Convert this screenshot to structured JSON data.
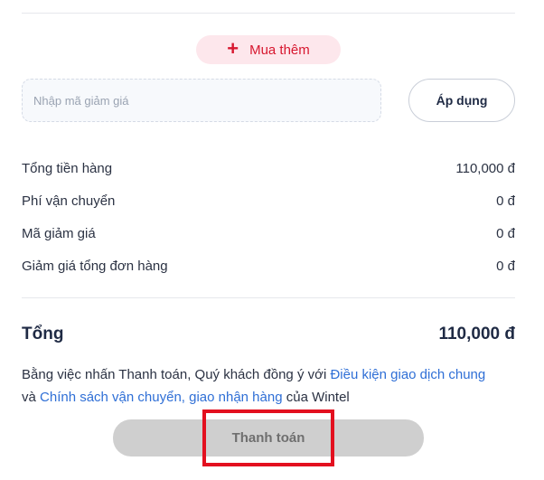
{
  "cart_actions": {
    "add_more_label": "Mua thêm",
    "add_more_icon": "plus-icon"
  },
  "coupon": {
    "placeholder": "Nhập mã giảm giá",
    "value": "",
    "apply_label": "Áp dụng"
  },
  "summary": {
    "rows": [
      {
        "label": "Tổng tiền hàng",
        "value": "110,000 đ"
      },
      {
        "label": "Phí vận chuyển",
        "value": "0 đ"
      },
      {
        "label": "Mã giảm giá",
        "value": "0 đ"
      },
      {
        "label": "Giảm giá tổng đơn hàng",
        "value": "0 đ"
      }
    ],
    "total_label": "Tổng",
    "total_value": "110,000 đ"
  },
  "terms": {
    "prefix": "Bằng việc nhấn Thanh toán, Quý khách đồng ý với ",
    "link1": "Điều kiện giao dịch chung",
    "middle": "và ",
    "link2": "Chính sách vận chuyển, giao nhận hàng",
    "suffix": " của Wintel"
  },
  "checkout": {
    "pay_label": "Thanh toán",
    "pay_enabled": false
  },
  "colors": {
    "accent": "#d7172f",
    "link": "#2f6fd6",
    "highlight": "#e3101f",
    "disabled_button": "#cfcfcf"
  }
}
